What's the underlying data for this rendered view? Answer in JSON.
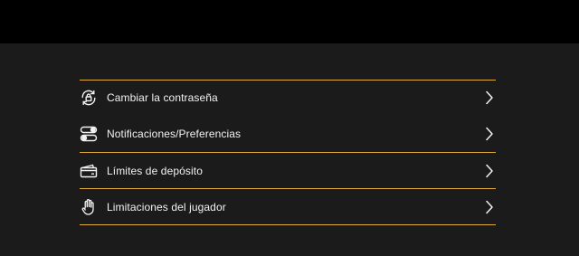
{
  "colors": {
    "accent": "#e0a93a",
    "background": "#1b1b1b",
    "topbar": "#000000",
    "text": "#f2f2f2"
  },
  "menu": {
    "items": [
      {
        "label": "Cambiar la contraseña",
        "icon": "lock-refresh-icon"
      },
      {
        "label": "Notificaciones/Preferencias",
        "icon": "toggles-icon"
      },
      {
        "label": "Límites de depósito",
        "icon": "wallet-icon"
      },
      {
        "label": "Limitaciones del jugador",
        "icon": "hand-stop-icon"
      }
    ]
  }
}
